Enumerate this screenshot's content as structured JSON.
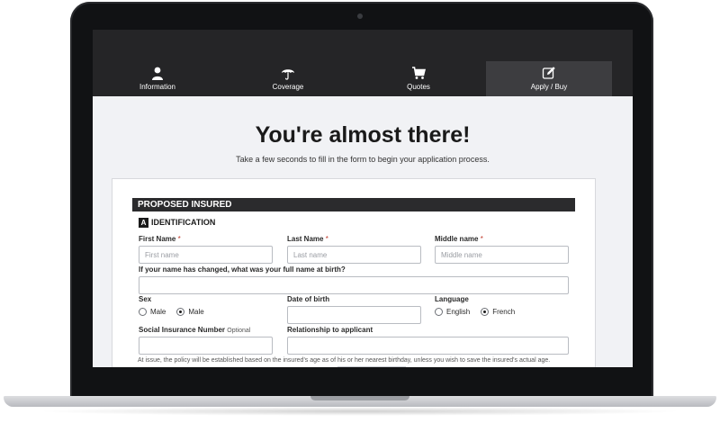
{
  "nav": {
    "items": [
      {
        "label": "Information",
        "icon": "user-icon"
      },
      {
        "label": "Coverage",
        "icon": "umbrella-icon"
      },
      {
        "label": "Quotes",
        "icon": "cart-icon"
      },
      {
        "label": "Apply / Buy",
        "icon": "edit-icon",
        "active": true
      }
    ]
  },
  "hero": {
    "title": "You're almost there!",
    "subtitle": "Take a few seconds to fill in the form to begin your application process."
  },
  "form": {
    "section_title": "PROPOSED INSURED",
    "subsection_badge": "A",
    "subsection_title": "IDENTIFICATION",
    "first_name": {
      "label": "First Name",
      "required_mark": "*",
      "placeholder": "First name",
      "value": ""
    },
    "last_name": {
      "label": "Last Name",
      "required_mark": "*",
      "placeholder": "Last name",
      "value": ""
    },
    "middle_name": {
      "label": "Middle name",
      "required_mark": "*",
      "placeholder": "Middle name",
      "value": ""
    },
    "previous_name": {
      "label": "If your name has changed, what was your full name at birth?",
      "value": ""
    },
    "sex": {
      "label": "Sex",
      "options": [
        "Male",
        "Male"
      ],
      "selected_index": 1
    },
    "dob": {
      "label": "Date of birth",
      "value": ""
    },
    "language": {
      "label": "Language",
      "options": [
        "English",
        "French"
      ],
      "selected_index": 1
    },
    "sin": {
      "label": "Social Insurance Number",
      "optional_label": "Optional",
      "value": ""
    },
    "relationship": {
      "label": "Relationship to applicant",
      "value": ""
    },
    "note": "At issue, the policy will be established based on the insured's age as of his or her nearest birthday, unless you wish to save the insured's actual age."
  },
  "colors": {
    "navbar": "#252527",
    "nav_active": "#3d3d40",
    "section_bar": "#2b2b2d",
    "required": "#c0392b"
  }
}
